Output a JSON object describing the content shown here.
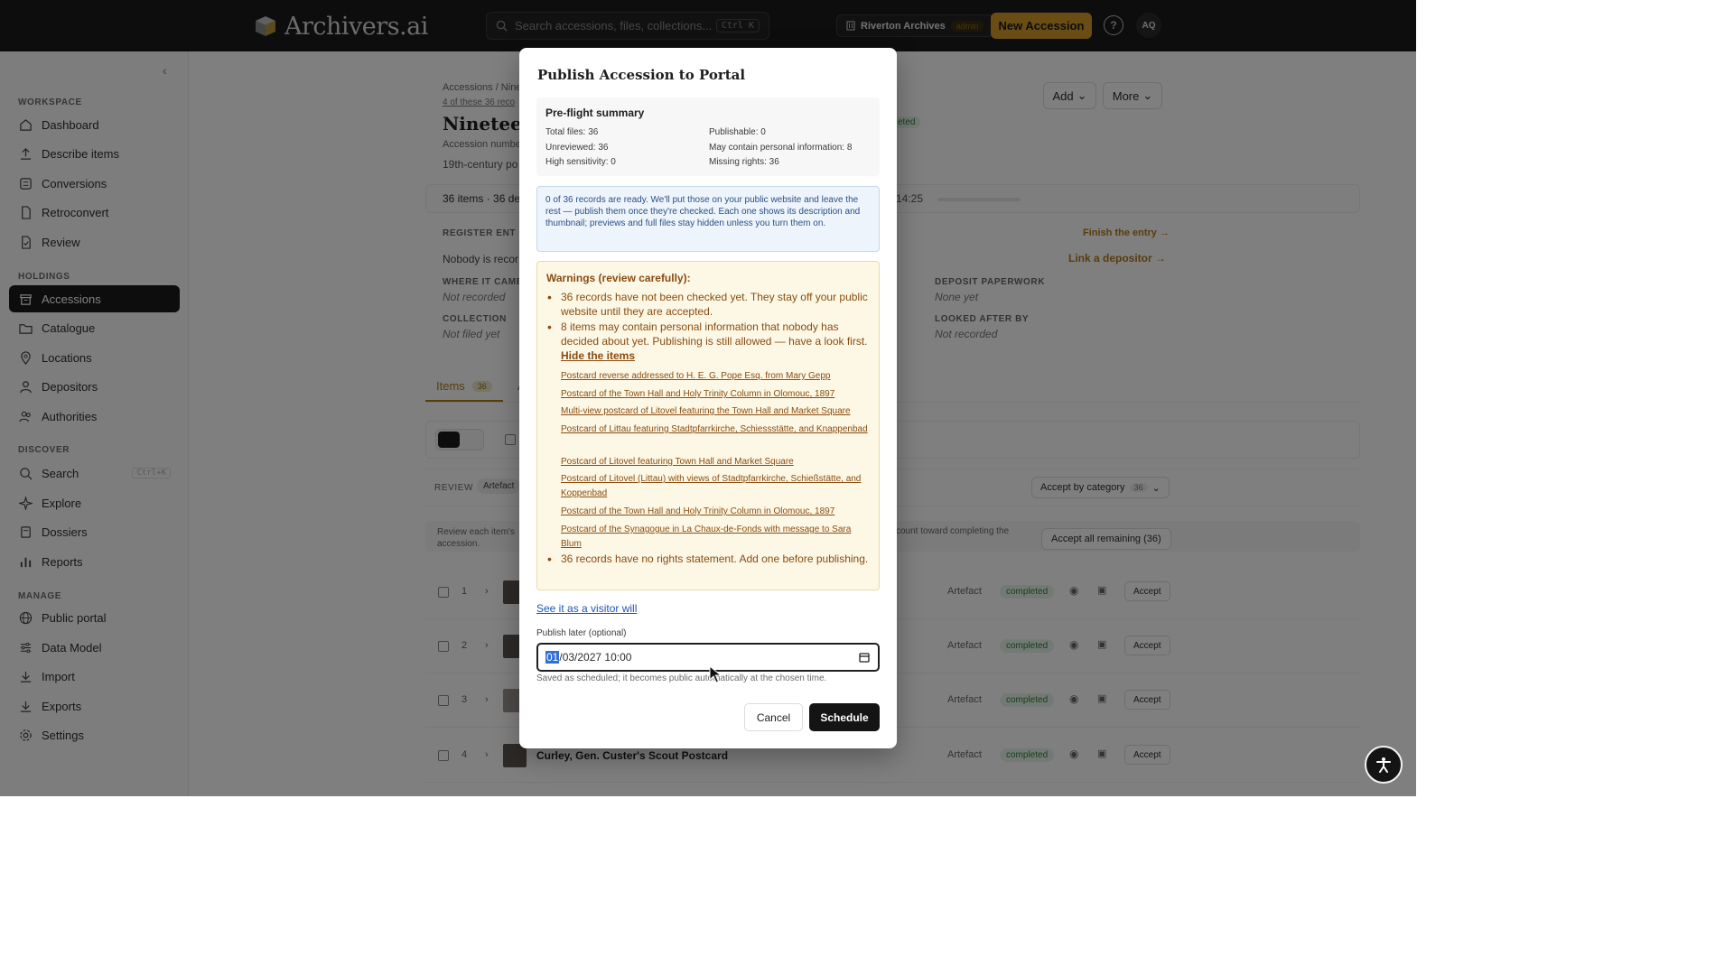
{
  "brand": {
    "name": "Archivers.ai"
  },
  "topbar": {
    "search_placeholder": "Search accessions, files, collections...",
    "search_shortcut": "Ctrl K",
    "org_name": "Riverton Archives",
    "org_role": "admin",
    "new_accession": "New Accession",
    "help_glyph": "?",
    "avatar_initials": "AQ"
  },
  "sidebar": {
    "sections": [
      {
        "title": "WORKSPACE",
        "items": [
          {
            "label": "Dashboard",
            "icon": "home-icon"
          },
          {
            "label": "Describe items",
            "icon": "upload-icon"
          },
          {
            "label": "Conversions",
            "icon": "list-icon"
          },
          {
            "label": "Retroconvert",
            "icon": "document-icon"
          },
          {
            "label": "Review",
            "icon": "file-check-icon"
          }
        ]
      },
      {
        "title": "HOLDINGS",
        "items": [
          {
            "label": "Accessions",
            "icon": "archive-box-icon",
            "active": true
          },
          {
            "label": "Catalogue",
            "icon": "folder-icon"
          },
          {
            "label": "Locations",
            "icon": "map-pin-icon"
          },
          {
            "label": "Depositors",
            "icon": "person-icon"
          },
          {
            "label": "Authorities",
            "icon": "people-icon"
          }
        ]
      },
      {
        "title": "DISCOVER",
        "items": [
          {
            "label": "Search",
            "icon": "search-icon",
            "shortcut": "Ctrl+K"
          },
          {
            "label": "Explore",
            "icon": "sparkle-icon"
          },
          {
            "label": "Dossiers",
            "icon": "stack-icon"
          },
          {
            "label": "Reports",
            "icon": "bar-chart-icon"
          }
        ]
      },
      {
        "title": "MANAGE",
        "items": [
          {
            "label": "Public portal",
            "icon": "globe-icon"
          },
          {
            "label": "Data Model",
            "icon": "sliders-icon"
          },
          {
            "label": "Import",
            "icon": "download-icon"
          },
          {
            "label": "Exports",
            "icon": "export-icon"
          },
          {
            "label": "Settings",
            "icon": "gear-icon"
          }
        ]
      }
    ]
  },
  "background": {
    "breadcrumb": "Accessions / Nine",
    "records_note": "4 of these 36 reco",
    "title": "Nineteent",
    "accession_number": "Accession number",
    "description": "19th-century po",
    "top_status": "eted",
    "add_button": "Add",
    "more_button": "More",
    "items_summary": "36 items · 36 de",
    "time_fragment": "14:25",
    "register_label": "REGISTER ENT",
    "register_message": "Nobody is recor",
    "finish_entry": "Finish the entry →",
    "link_depositor": "Link a depositor →",
    "fields": [
      {
        "label": "WHERE IT CAME",
        "value": "Not recorded"
      },
      {
        "label": "COLLECTION",
        "value": "Not filed yet"
      },
      {
        "label": "DEPOSIT PAPERWORK",
        "value": "None yet"
      },
      {
        "label": "LOOKED AFTER BY",
        "value": "Not recorded"
      }
    ],
    "tab_items": "Items",
    "tab_items_count": "36",
    "tab_second": "A",
    "review_label": "REVIEW",
    "artefact_chip": "Artefact",
    "accept_by_category": "Accept by category",
    "accept_by_category_count": "36",
    "hint_left": "Review each item's accession.",
    "hint_right": "count toward completing the",
    "accept_all": "Accept all remaining (36)",
    "rows": [
      {
        "num": "1",
        "title": "",
        "type": "Artefact",
        "status": "completed",
        "action": "Accept"
      },
      {
        "num": "2",
        "title": "",
        "type": "Artefact",
        "status": "completed",
        "action": "Accept"
      },
      {
        "num": "3",
        "title": "",
        "type": "Artefact",
        "status": "completed",
        "action": "Accept"
      },
      {
        "num": "4",
        "title": "Curley, Gen. Custer's Scout Postcard",
        "type": "Artefact",
        "status": "completed",
        "action": "Accept"
      }
    ]
  },
  "modal": {
    "title": "Publish Accession to Portal",
    "preflight": {
      "title": "Pre-flight summary",
      "stats": {
        "total_files": "Total files: 36",
        "unreviewed": "Unreviewed: 36",
        "high_sensitivity": "High sensitivity: 0",
        "publishable": "Publishable: 0",
        "personal_info": "May contain personal information: 8",
        "missing_rights": "Missing rights: 36"
      }
    },
    "info": "0 of 36 records are ready. We'll put those on your public website and leave the rest — publish them once they're checked. Each one shows its description and thumbnail; previews and full files stay hidden unless you turn them on.",
    "warnings": {
      "title": "Warnings (review carefully):",
      "unchecked": "36 records have not been checked yet. They stay off your public website until they are accepted.",
      "personal": "8 items may contain personal information that nobody has decided about yet. Publishing is still allowed — have a look first.",
      "hide_items": "Hide the items",
      "items": [
        "Postcard reverse addressed to H. E. G. Pope Esq. from Mary Gepp",
        "Postcard of the Town Hall and Holy Trinity Column in Olomouc, 1897",
        "Multi-view postcard of Litovel featuring the Town Hall and Market Square",
        "Postcard of Littau featuring Stadtpfarrkirche, Schiessstätte, and Knappenbad",
        "Postcard of Litovel featuring Town Hall and Market Square",
        "Postcard of Litovel (Littau) with views of Stadtpfarrkirche, Schießstätte, and Koppenbad",
        "Postcard of the Town Hall and Holy Trinity Column in Olomouc, 1897",
        "Postcard of the Synagogue in La Chaux-de-Fonds with message to Sara Blum"
      ],
      "rights": "36 records have no rights statement. Add one before publishing."
    },
    "visitor_link": "See it as a visitor will",
    "publish_later_label": "Publish later (optional)",
    "datetime_selected": "01",
    "datetime_rest": "/03/2027 10:00",
    "publish_help": "Saved as scheduled; it becomes public automatically at the chosen time.",
    "cancel": "Cancel",
    "schedule": "Schedule"
  }
}
